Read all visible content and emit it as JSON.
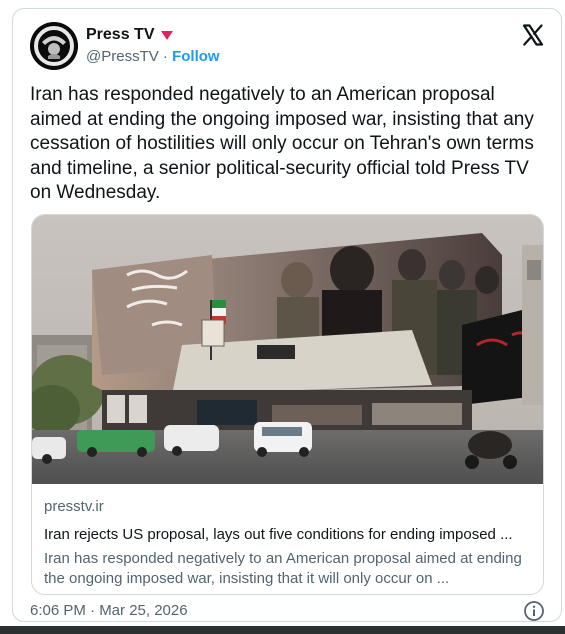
{
  "tweet": {
    "author_name": "Press TV",
    "handle": "@PressTV",
    "separator": "·",
    "follow_label": "Follow",
    "text": "Iran has responded negatively to an American proposal aimed at ending the ongoing imposed war, insisting that any cessation of hostilities will only occur on Tehran's own terms and timeline, a senior political-security official told Press TV on Wednesday.",
    "timestamp": "6:06 PM · Mar 25, 2026"
  },
  "link_card": {
    "domain": "presstv.ir",
    "title": "Iran rejects US proposal, lays out five conditions for ending imposed ...",
    "description": "Iran has responded negatively to an American proposal aimed at ending the ongoing imposed war, insisting that it will only occur on ...",
    "image_icon": "photo-billboard-street-scene"
  },
  "icons": {
    "platform": "x-logo-icon",
    "verified": "verified-badge-icon",
    "info": "info-icon"
  },
  "colors": {
    "link_blue": "#1d9bf0",
    "secondary_text": "#536471",
    "verified_badge": "#e0245e",
    "border": "#cfd9de"
  }
}
